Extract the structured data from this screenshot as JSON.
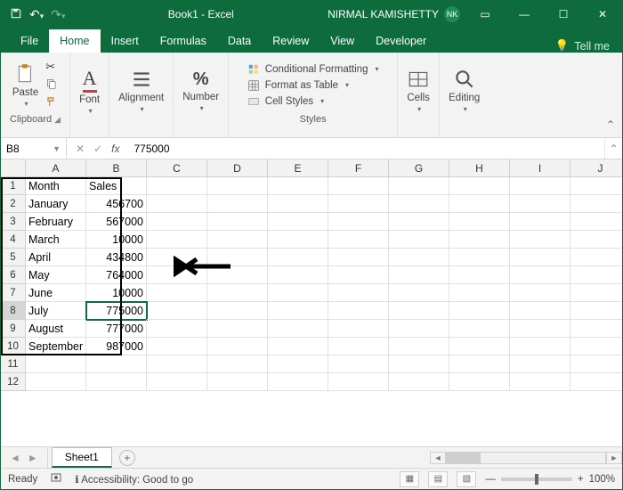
{
  "titlebar": {
    "title": "Book1 - Excel",
    "user": "NIRMAL KAMISHETTY",
    "initials": "NK"
  },
  "tabs": [
    "File",
    "Home",
    "Insert",
    "Formulas",
    "Data",
    "Review",
    "View",
    "Developer"
  ],
  "tabs_active": 1,
  "tellme": "Tell me",
  "ribbon": {
    "clipboard": {
      "label": "Clipboard",
      "paste": "Paste"
    },
    "font": {
      "label": "Font"
    },
    "alignment": {
      "label": "Alignment"
    },
    "number": {
      "label": "Number"
    },
    "styles": {
      "label": "Styles",
      "conditional": "Conditional Formatting",
      "table": "Format as Table",
      "cell": "Cell Styles"
    },
    "cells": {
      "label": "Cells"
    },
    "editing": {
      "label": "Editing"
    }
  },
  "formula": {
    "cellref": "B8",
    "value": "775000"
  },
  "columns": [
    "A",
    "B",
    "C",
    "D",
    "E",
    "F",
    "G",
    "H",
    "I",
    "J"
  ],
  "rowcount": 12,
  "active": {
    "row": 8,
    "col": 1
  },
  "grid": [
    [
      "Month",
      "Sales"
    ],
    [
      "January",
      "456700"
    ],
    [
      "February",
      "567000"
    ],
    [
      "March",
      "10000"
    ],
    [
      "April",
      "434800"
    ],
    [
      "May",
      "764000"
    ],
    [
      "June",
      "10000"
    ],
    [
      "July",
      "775000"
    ],
    [
      "August",
      "777000"
    ],
    [
      "September",
      "987000"
    ]
  ],
  "data_border": {
    "rows": 10,
    "cols": 2
  },
  "sheets": [
    "Sheet1"
  ],
  "status": {
    "mode": "Ready",
    "accessibility": "Accessibility: Good to go",
    "zoom": "100%"
  }
}
